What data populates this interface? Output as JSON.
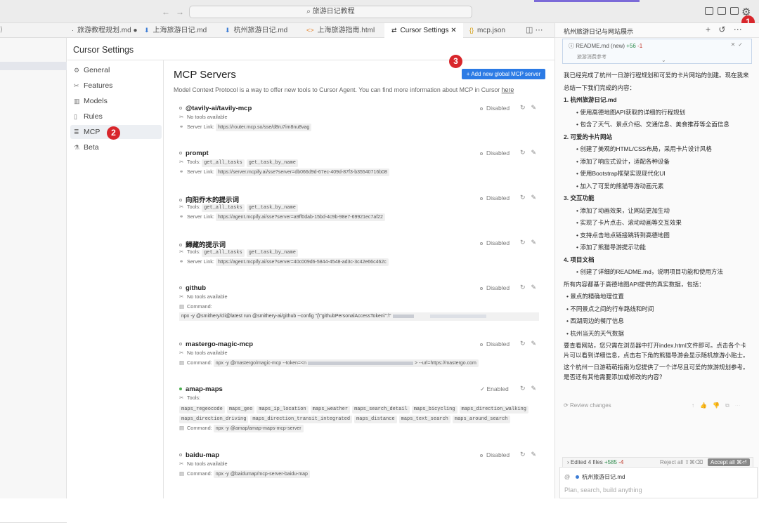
{
  "window": {
    "search_text": "旅游日记教程"
  },
  "tabs": [
    {
      "label": "旅游教程规划.md",
      "icon": "markdown",
      "modified": true
    },
    {
      "label": "上海旅游日记.md",
      "icon": "markdown-down"
    },
    {
      "label": "杭州旅游日记.md",
      "icon": "markdown-down"
    },
    {
      "label": "上海旅游指南.html",
      "icon": "html"
    },
    {
      "label": "Cursor Settings",
      "icon": "settings",
      "active": true
    },
    {
      "label": "mcp.json",
      "icon": "json"
    }
  ],
  "settings": {
    "title": "Cursor Settings",
    "nav": [
      {
        "label": "General",
        "icon": "gear-icon"
      },
      {
        "label": "Features",
        "icon": "tools-icon"
      },
      {
        "label": "Models",
        "icon": "bars-icon"
      },
      {
        "label": "Rules",
        "icon": "doc-icon"
      },
      {
        "label": "MCP",
        "icon": "list-icon",
        "active": true
      },
      {
        "label": "Beta",
        "icon": "flask-icon"
      }
    ]
  },
  "mcp": {
    "title": "MCP Servers",
    "add_button": "+ Add new global MCP server",
    "description": "Model Context Protocol is a way to offer new tools to Cursor Agent. You can find more information about MCP in Cursor ",
    "description_link": "here",
    "servers": [
      {
        "name": "@tavily-ai/tavily-mcp",
        "status": "Disabled",
        "tools_text": "No tools available",
        "link_label": "Server Link:",
        "link": "https://router.mcp.so/sse/d8ru7im8nu8vag"
      },
      {
        "name": "prompt",
        "status": "Disabled",
        "tools_label": "Tools:",
        "tools": [
          "get_all_tasks",
          "get_task_by_name"
        ],
        "link_label": "Server Link:",
        "link": "https://server.mcpify.ai/sse?server=db066d9d-67ec-409d-87f3-b35540716b08"
      },
      {
        "name": "向阳乔木的提示词",
        "status": "Disabled",
        "tools_label": "Tools:",
        "tools": [
          "get_all_tasks",
          "get_task_by_name"
        ],
        "link_label": "Server Link:",
        "link": "https://agent.mcpify.ai/sse?server=a9ff0dab-15bd-4c9b-98e7-69921ec7af22"
      },
      {
        "name": "歸藏的提示词",
        "status": "Disabled",
        "tools_label": "Tools:",
        "tools": [
          "get_all_tasks",
          "get_task_by_name"
        ],
        "link_label": "Server Link:",
        "link": "https://agent.mcpify.ai/sse?server=40c009d6-5844-4548-ad3c-3c42e66c462c"
      },
      {
        "name": "github",
        "status": "Disabled",
        "tools_text": "No tools available",
        "cmd_label": "Command:",
        "cmd_box": "npx -y @smithery/cli@latest run @smithery-ai/github --config \"{\\\"githubPersonalAccessToken\\\":\\\""
      },
      {
        "name": "mastergo-magic-mcp",
        "status": "Disabled",
        "tools_text": "No tools available",
        "cmd_label": "Command:",
        "cmd": "npx -y @mastergo/magic-mcp --token=<n",
        "cmd_tail": "> --url=https://mastergo.com"
      },
      {
        "name": "amap-maps",
        "status": "Enabled",
        "tools_label": "Tools:",
        "tools_rows": [
          [
            "maps_regeocode",
            "maps_geo",
            "maps_ip_location",
            "maps_weather",
            "maps_search_detail",
            "maps_bicycling",
            "maps_direction_walking"
          ],
          [
            "maps_direction_driving",
            "maps_direction_transit_integrated",
            "maps_distance",
            "maps_text_search",
            "maps_around_search"
          ]
        ],
        "cmd_label": "Command:",
        "cmd": "npx -y @amap/amap-maps-mcp-server"
      },
      {
        "name": "baidu-map",
        "status": "Disabled",
        "tools_text": "No tools available",
        "cmd_label": "Command:",
        "cmd": "npx -y @baidumap/mcp-server-baidu-map"
      }
    ]
  },
  "chat": {
    "tab_title": "杭州旅游日记与网站展示",
    "readme": {
      "file": "README.md",
      "tag": "(new)",
      "added": "+56",
      "removed": "-1",
      "sub": "旅游消费参考"
    },
    "intro": "我已经完成了杭州一日游行程规划和可爱的卡片网站的创建。现在我来总结一下我们完成的内容：",
    "sections": [
      {
        "heading": "1. 杭州旅游日记.md",
        "items": [
          "使用高德地图API获取的详细的行程规划",
          "包含了天气、景点介绍、交通信息、美食推荐等全面信息"
        ]
      },
      {
        "heading": "2. 可爱的卡片网站",
        "items": [
          "创建了美观的HTML/CSS布局，采用卡片设计风格",
          "添加了响应式设计，适配各种设备",
          "使用Bootstrap框架实现现代化UI",
          "加入了可爱的熊猫导游动画元素"
        ]
      },
      {
        "heading": "3. 交互功能",
        "items": [
          "添加了动画效果，让网站更加生动",
          "实现了卡片点击、滚动动画等交互效果",
          "支持点击地点链接跳转到高德地图",
          "添加了熊猫导游提示功能"
        ]
      },
      {
        "heading": "4. 项目文档",
        "items": [
          "创建了详细的README.md，说明项目功能和使用方法"
        ]
      }
    ],
    "data_intro": "所有内容都基于高德地图API提供的真实数据，包括：",
    "data_items": [
      "景点的精确地理位置",
      "不同景点之间的行车路线和时间",
      "西湖周边的餐厅信息",
      "杭州当天的天气数据"
    ],
    "outro1": "要查看网站，您只需在浏览器中打开index.html文件即可。点击各个卡片可以看到详细信息，点击右下角的熊猫导游会显示随机旅游小贴士。",
    "outro2": "这个杭州一日游萌萌指南为您提供了一个详尽且可爱的旅游规划参考。是否还有其他需要添加或修改的内容？",
    "review_label": "Review changes",
    "edited": {
      "label": "Edited 4 files",
      "added": "+585",
      "removed": "-4",
      "reject": "Reject all ⇧⌘⌫",
      "accept": "Accept all ⌘⏎"
    },
    "context_file": "杭州旅游日记.md",
    "placeholder": "Plan, search, build anything"
  },
  "badges": [
    "1",
    "2",
    "3"
  ],
  "colors": {
    "accent": "#2c7be5",
    "badge": "#d8262b",
    "enabled": "#4caf50"
  }
}
